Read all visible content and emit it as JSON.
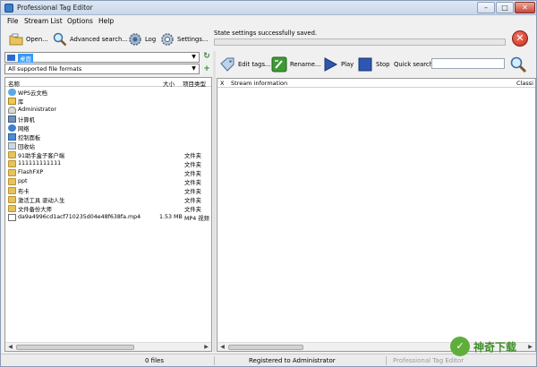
{
  "window": {
    "title": "Professional Tag Editor",
    "minimize": "–",
    "maximize": "□",
    "close": "✕"
  },
  "menu": [
    "File",
    "Stream List",
    "Options",
    "Help"
  ],
  "toolbar": {
    "open_label": "Open...",
    "advanced_search_label": "Advanced search...",
    "log_label": "Log",
    "settings_label": "Settings..."
  },
  "status": {
    "message": "State settings successfully saved.",
    "progress": 0
  },
  "path": {
    "current": "桌面",
    "format_filter": "All supported file formats"
  },
  "file_list": {
    "columns": {
      "name": "名称",
      "size": "大小",
      "type": "项目类型"
    },
    "rows": [
      {
        "name": "WPS云文档",
        "size": "",
        "type": "",
        "icon": "cloud-icon"
      },
      {
        "name": "库",
        "size": "",
        "type": "",
        "icon": "library-icon"
      },
      {
        "name": "Administrator",
        "size": "",
        "type": "",
        "icon": "user-icon"
      },
      {
        "name": "计算机",
        "size": "",
        "type": "",
        "icon": "computer-icon"
      },
      {
        "name": "网络",
        "size": "",
        "type": "",
        "icon": "network-icon"
      },
      {
        "name": "控制面板",
        "size": "",
        "type": "",
        "icon": "control-panel-icon"
      },
      {
        "name": "回收站",
        "size": "",
        "type": "",
        "icon": "recycle-bin-icon"
      },
      {
        "name": "91助手盒子客户端",
        "size": "",
        "type": "文件夹",
        "icon": "folder-icon"
      },
      {
        "name": "111111111111",
        "size": "",
        "type": "文件夹",
        "icon": "folder-icon"
      },
      {
        "name": "FlashFXP",
        "size": "",
        "type": "文件夹",
        "icon": "folder-icon"
      },
      {
        "name": "ppt",
        "size": "",
        "type": "文件夹",
        "icon": "folder-icon"
      },
      {
        "name": "布卡",
        "size": "",
        "type": "文件夹",
        "icon": "folder-icon"
      },
      {
        "name": "激活工具 驱动人生",
        "size": "",
        "type": "文件夹",
        "icon": "folder-icon"
      },
      {
        "name": "文件备份大师",
        "size": "",
        "type": "文件夹",
        "icon": "folder-icon"
      },
      {
        "name": "da9a4996cd1acf710235d04e48f638fa.mp4",
        "size": "1.53 MB",
        "type": "MP4 视频",
        "icon": "video-file-icon"
      }
    ]
  },
  "right_toolbar": {
    "edit_tags_label": "Edit tags...",
    "rename_label": "Rename...",
    "play_label": "Play",
    "stop_label": "Stop",
    "quick_search_label": "Quick search:",
    "quick_search_value": ""
  },
  "stream_list": {
    "columns": {
      "x": "X",
      "stream_info": "Stream information",
      "classic": "Classi"
    }
  },
  "statusbar": {
    "files": "0 files",
    "registered": "Registered to Administrator",
    "product": "Professional Tag Editor"
  },
  "watermark": {
    "logo": "✓",
    "text": "神奇下载"
  },
  "colors": {
    "accent": "#3399ff",
    "folder": "#e8c25a",
    "progress": "#3caa3c",
    "stop": "#c6271b"
  }
}
